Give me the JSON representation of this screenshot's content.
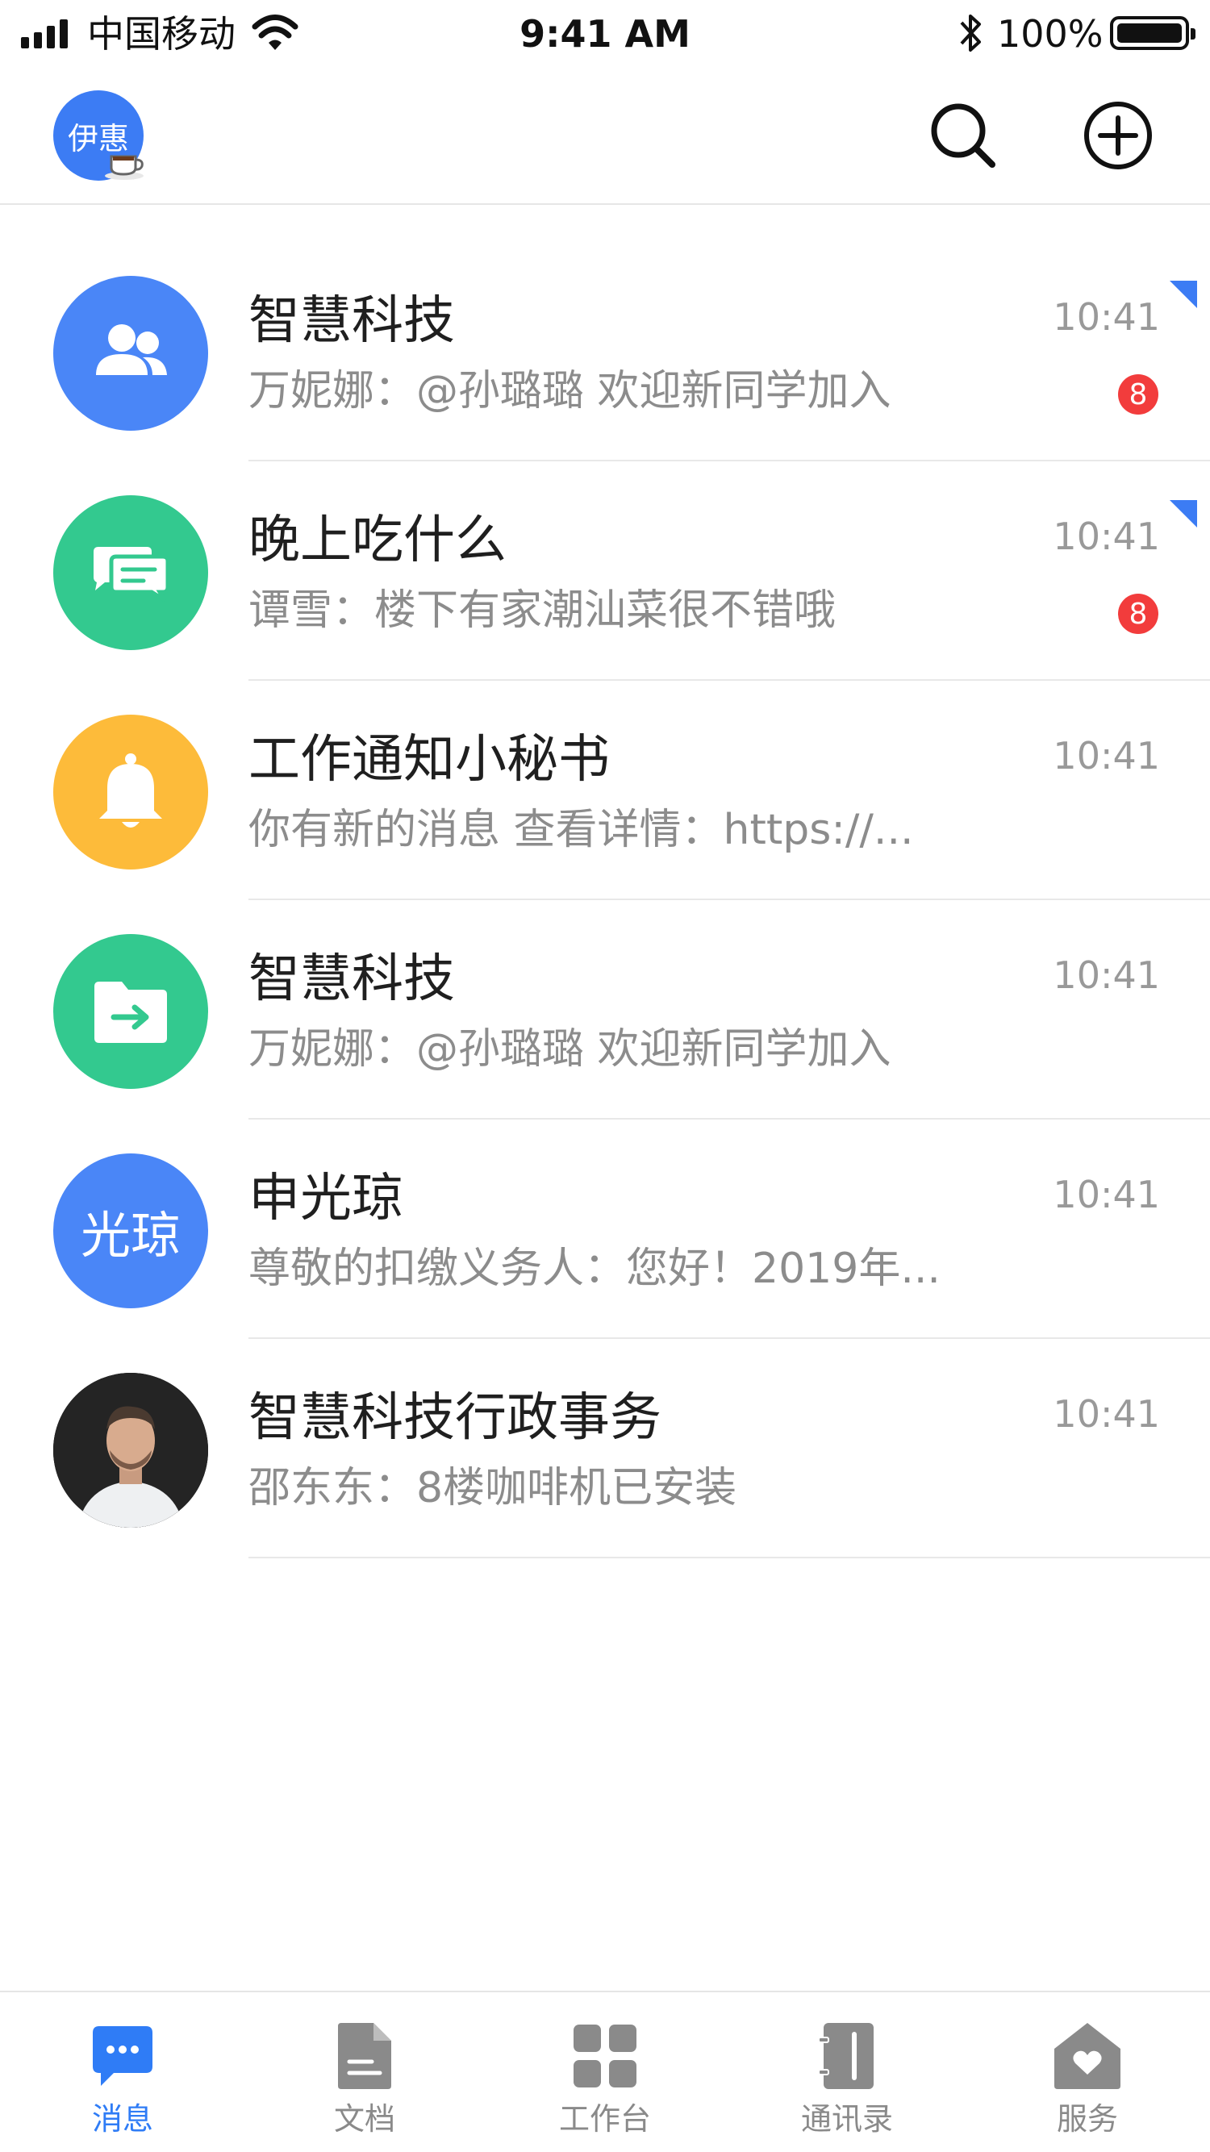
{
  "status_bar": {
    "carrier": "中国移动",
    "time": "9:41 AM",
    "battery": "100%"
  },
  "header": {
    "me_avatar_text": "伊惠",
    "search_icon": "search-icon",
    "add_icon": "plus-circle-icon"
  },
  "chats": [
    {
      "title": "智慧科技",
      "preview": "万妮娜：@孙璐璐 欢迎新同学加入",
      "time": "10:41",
      "badge": "8",
      "pinned": true,
      "avatar_color": "#4a86f7",
      "avatar_icon": "group-icon"
    },
    {
      "title": "晚上吃什么",
      "preview": "谭雪：楼下有家潮汕菜很不错哦",
      "time": "10:41",
      "badge": "8",
      "pinned": true,
      "avatar_color": "#33c98f",
      "avatar_icon": "chat-bubbles-icon"
    },
    {
      "title": "工作通知小秘书",
      "preview": "你有新的消息 查看详情：https://...",
      "time": "10:41",
      "avatar_color": "#fdbb3a",
      "avatar_icon": "bell-icon"
    },
    {
      "title": "智慧科技",
      "preview": "万妮娜：@孙璐璐 欢迎新同学加入",
      "time": "10:41",
      "avatar_color": "#33c98f",
      "avatar_icon": "folder-share-icon"
    },
    {
      "title": "申光琼",
      "preview": "尊敬的扣缴义务人：您好！2019年...",
      "time": "10:41",
      "avatar_color": "#4a86f7",
      "avatar_text": "光琼"
    },
    {
      "title": "智慧科技行政事务",
      "preview": "邵东东：8楼咖啡机已安装",
      "time": "10:41",
      "avatar_icon": "person-photo-icon"
    }
  ],
  "tabs": [
    {
      "label": "消息",
      "icon": "message-icon",
      "active": true
    },
    {
      "label": "文档",
      "icon": "document-icon"
    },
    {
      "label": "工作台",
      "icon": "grid-icon"
    },
    {
      "label": "通讯录",
      "icon": "contacts-icon"
    },
    {
      "label": "服务",
      "icon": "service-home-icon"
    }
  ],
  "colors": {
    "accent": "#2f7cf6",
    "badge": "#f23c3c",
    "tab_inactive": "#8a8a8a"
  }
}
